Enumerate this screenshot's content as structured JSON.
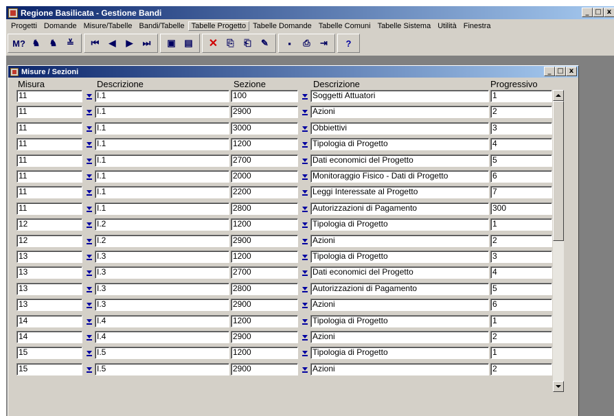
{
  "app": {
    "title": "Regione Basilicata - Gestione Bandi",
    "min": "_",
    "max": "□",
    "close": "x"
  },
  "menu": [
    "Progetti",
    "Domande",
    "Misure/Tabelle",
    "Bandi/Tabelle",
    "Tabelle Progetto",
    "Tabelle Domande",
    "Tabelle Comuni",
    "Tabelle Sistema",
    "Utilità",
    "Finestra"
  ],
  "toolbar": {
    "buttons": [
      {
        "name": "query-icon",
        "glyph": "M?"
      },
      {
        "name": "find-icon",
        "glyph": "♞"
      },
      {
        "name": "find-next-icon",
        "glyph": "♞"
      },
      {
        "name": "filter-icon",
        "glyph": "≚"
      },
      {
        "name": "first-record-icon",
        "glyph": "⏮"
      },
      {
        "name": "prev-record-icon",
        "glyph": "◀"
      },
      {
        "name": "next-record-icon",
        "glyph": "▶"
      },
      {
        "name": "last-record-icon",
        "glyph": "⏭"
      },
      {
        "name": "new-record-icon",
        "glyph": "▣"
      },
      {
        "name": "edit-record-icon",
        "glyph": "▤"
      },
      {
        "name": "delete-icon",
        "glyph": "✕"
      },
      {
        "name": "copy-icon",
        "glyph": "⎘"
      },
      {
        "name": "paste-icon",
        "glyph": "⎗"
      },
      {
        "name": "pen-icon",
        "glyph": "✎"
      },
      {
        "name": "save-icon",
        "glyph": "▪"
      },
      {
        "name": "print-icon",
        "glyph": "⎙"
      },
      {
        "name": "exit-icon",
        "glyph": "⇥"
      },
      {
        "name": "help-icon",
        "glyph": "?"
      }
    ]
  },
  "child": {
    "title": "Misure / Sezioni",
    "columns": {
      "misura": "Misura",
      "descrizione1": "Descrizione",
      "sezione": "Sezione",
      "descrizione2": "Descrizione",
      "progressivo": "Progressivo"
    },
    "rows": [
      {
        "misura": "11",
        "desc1": "I.1",
        "sezione": "100",
        "desc2": "Soggetti Attuatori",
        "prog": "1"
      },
      {
        "misura": "11",
        "desc1": "I.1",
        "sezione": "2900",
        "desc2": "Azioni",
        "prog": "2"
      },
      {
        "misura": "11",
        "desc1": "I.1",
        "sezione": "3000",
        "desc2": "Obbiettivi",
        "prog": "3"
      },
      {
        "misura": "11",
        "desc1": "I.1",
        "sezione": "1200",
        "desc2": "Tipologia di Progetto",
        "prog": "4"
      },
      {
        "misura": "11",
        "desc1": "I.1",
        "sezione": "2700",
        "desc2": "Dati economici del Progetto",
        "prog": "5"
      },
      {
        "misura": "11",
        "desc1": "I.1",
        "sezione": "2000",
        "desc2": "Monitoraggio Fisico - Dati di Progetto",
        "prog": "6"
      },
      {
        "misura": "11",
        "desc1": "I.1",
        "sezione": "2200",
        "desc2": "Leggi Interessate al Progetto",
        "prog": "7"
      },
      {
        "misura": "11",
        "desc1": "I.1",
        "sezione": "2800",
        "desc2": "Autorizzazioni di Pagamento",
        "prog": "300"
      },
      {
        "misura": "12",
        "desc1": "I.2",
        "sezione": "1200",
        "desc2": "Tipologia di Progetto",
        "prog": "1"
      },
      {
        "misura": "12",
        "desc1": "I.2",
        "sezione": "2900",
        "desc2": "Azioni",
        "prog": "2"
      },
      {
        "misura": "13",
        "desc1": "I.3",
        "sezione": "1200",
        "desc2": "Tipologia di Progetto",
        "prog": "3"
      },
      {
        "misura": "13",
        "desc1": "I.3",
        "sezione": "2700",
        "desc2": "Dati economici del Progetto",
        "prog": "4"
      },
      {
        "misura": "13",
        "desc1": "I.3",
        "sezione": "2800",
        "desc2": "Autorizzazioni di Pagamento",
        "prog": "5"
      },
      {
        "misura": "13",
        "desc1": "I.3",
        "sezione": "2900",
        "desc2": "Azioni",
        "prog": "6"
      },
      {
        "misura": "14",
        "desc1": "I.4",
        "sezione": "1200",
        "desc2": "Tipologia di Progetto",
        "prog": "1"
      },
      {
        "misura": "14",
        "desc1": "I.4",
        "sezione": "2900",
        "desc2": "Azioni",
        "prog": "2"
      },
      {
        "misura": "15",
        "desc1": "I.5",
        "sezione": "1200",
        "desc2": "Tipologia di Progetto",
        "prog": "1"
      },
      {
        "misura": "15",
        "desc1": "I.5",
        "sezione": "2900",
        "desc2": "Azioni",
        "prog": "2"
      }
    ]
  }
}
